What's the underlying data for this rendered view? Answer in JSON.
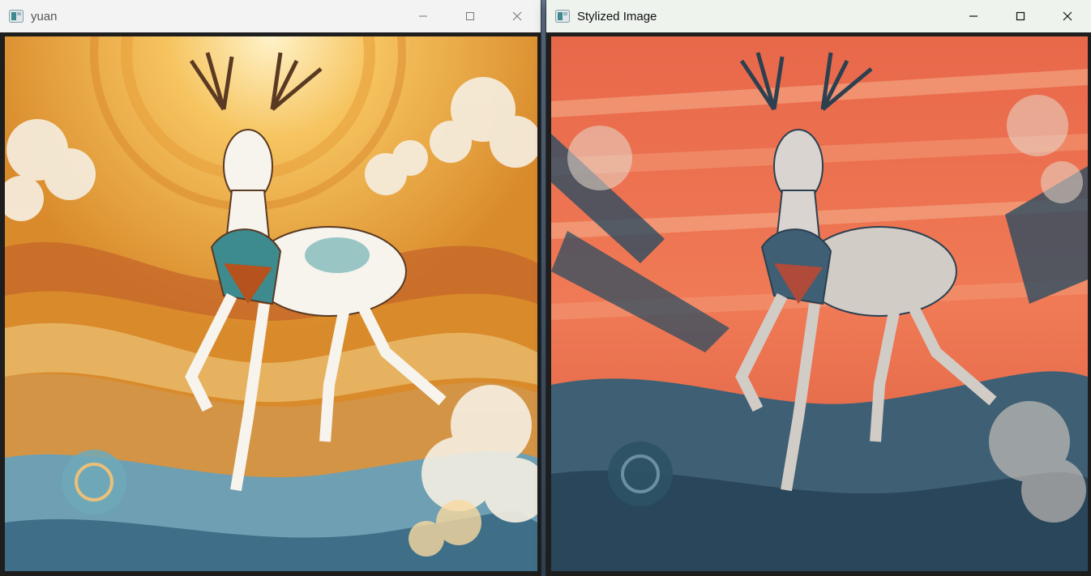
{
  "windows": [
    {
      "id": "original",
      "title": "yuan",
      "controls": [
        "minimize-icon",
        "maximize-icon",
        "close-icon"
      ]
    },
    {
      "id": "stylized",
      "title": "Stylized Image",
      "controls": [
        "minimize-icon",
        "maximize-icon",
        "close-icon"
      ]
    }
  ],
  "colors": {
    "original_palette": [
      "#f2c26a",
      "#d98a2b",
      "#b5521d",
      "#6f9fb2",
      "#f6efe2"
    ],
    "stylized_palette": [
      "#e85e3c",
      "#f3a37d",
      "#2c4c62",
      "#6c8fa0",
      "#e8d9cc"
    ]
  }
}
